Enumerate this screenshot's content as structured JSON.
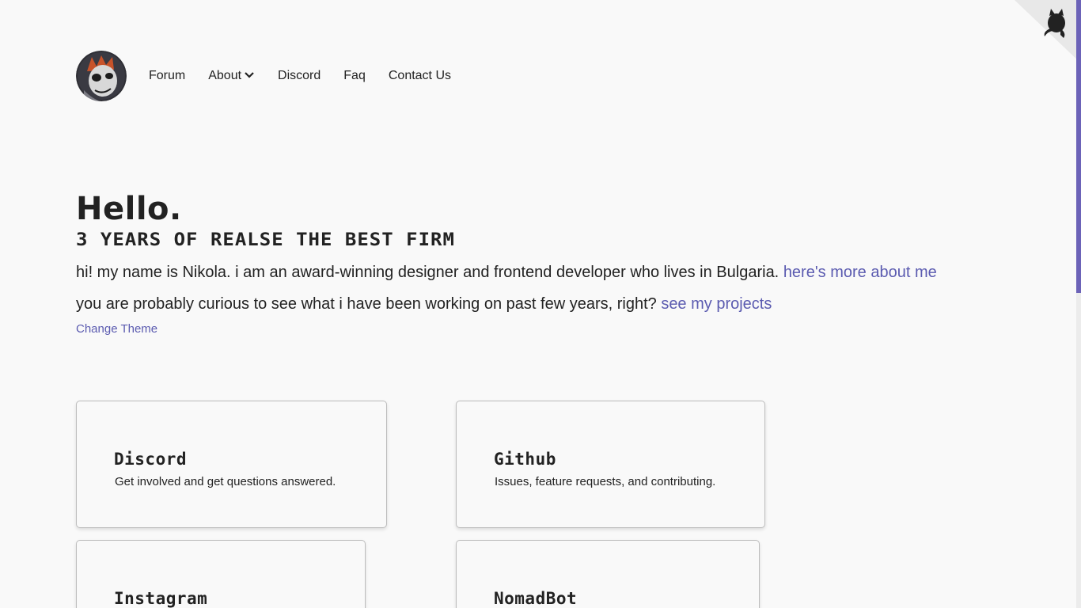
{
  "nav": {
    "items": [
      {
        "label": "Forum"
      },
      {
        "label": "About"
      },
      {
        "label": "Discord"
      },
      {
        "label": "Faq"
      },
      {
        "label": "Contact Us"
      }
    ]
  },
  "hero": {
    "greeting": "Hello.",
    "tagline": "3 years of realse the best firm",
    "line1_text": "hi! my name is Nikola. i am an award-winning designer and frontend developer who lives in Bulgaria.",
    "line1_link": "here's more about me",
    "line2_text": "you are probably curious to see what i have been working on past few years, right?",
    "line2_link": "see my projects",
    "theme_link": "Change Theme"
  },
  "cards": [
    {
      "title": "Discord",
      "description": "Get involved and get questions answered."
    },
    {
      "title": "Github",
      "description": "Issues, feature requests, and contributing."
    },
    {
      "title": "Instagram",
      "description": ""
    },
    {
      "title": "NomadBot",
      "description": ""
    }
  ],
  "colors": {
    "accent": "#5b5bb0",
    "scrollbar": "#6c63b8",
    "background": "#f9f9f9",
    "text": "#222222"
  },
  "icons": {
    "github_corner": "octocat-icon",
    "about_dropdown": "chevron-down-icon"
  }
}
